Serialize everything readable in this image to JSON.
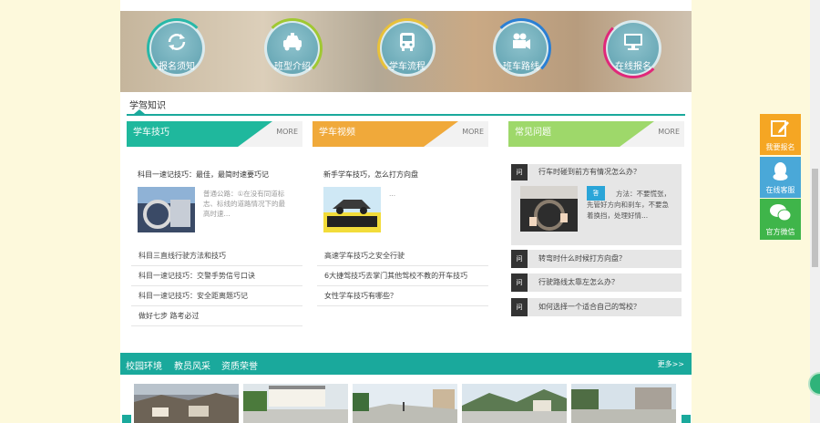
{
  "hero": {
    "items": [
      {
        "label": "报名须知",
        "icon": "refresh-icon",
        "arc_color": "#28b8a8"
      },
      {
        "label": "班型介绍",
        "icon": "car-icon",
        "arc_color": "#a0c832"
      },
      {
        "label": "学车流程",
        "icon": "bus-icon",
        "arc_color": "#e8c13a"
      },
      {
        "label": "班车路线",
        "icon": "camera-icon",
        "arc_color": "#2a7fd4"
      },
      {
        "label": "在线报名",
        "icon": "monitor-icon",
        "arc_color": "#e0287a"
      }
    ]
  },
  "knowledge": {
    "title": "学驾知识",
    "accent": "#1aa99c"
  },
  "columns": [
    {
      "tab": "学车技巧",
      "more": "MORE",
      "color": "#1fb89d",
      "feature_title": "科目一速记技巧：最佳，最简时速要巧记",
      "feature_text": "普通公路：①在没有同道标志、标线的道路情况下的最高时速...",
      "list": [
        "科目三直线行驶方法和技巧",
        "科目一速记技巧：交警手势信号口诀",
        "科目一速记技巧：安全距离题巧记",
        "做好七步 路考必过"
      ]
    },
    {
      "tab": "学车视频",
      "more": "MORE",
      "color": "#f0a93a",
      "feature_title": "新手学车技巧，怎么打方向盘",
      "feature_text": "...",
      "list": [
        "高速学车技巧之安全行驶",
        "6大捷驾技巧去掌门其他驾校不教的开车技巧",
        "女性学车技巧有哪些？"
      ]
    },
    {
      "tab": "常见问题",
      "more": "MORE",
      "color": "#9ed86a",
      "q_badge": "问",
      "a_badge": "答",
      "featured_q": "行车时碰到前方有情况怎么办？",
      "featured_a": "方法：不要慌张，先管好方向和刹车，不要急着换挡，处理好情...",
      "list": [
        "转弯时什么时候打方向盘？",
        "行驶路线太靠左怎么办？",
        "如何选择一个适合自己的驾校？"
      ]
    }
  ],
  "gallery": {
    "tabs": [
      "校园环境",
      "教员风采",
      "资质荣誉"
    ],
    "more": "更多>>",
    "images": [
      "campus-village",
      "campus-building",
      "campus-court",
      "campus-mountain",
      "campus-yard"
    ]
  },
  "sidebar": {
    "buttons": [
      {
        "label": "我要报名",
        "icon": "edit-icon",
        "color": "#f5a623"
      },
      {
        "label": "在线客服",
        "icon": "qq-icon",
        "color": "#4aa8d8"
      },
      {
        "label": "官方微信",
        "icon": "wechat-icon",
        "color": "#3fb54a"
      }
    ]
  }
}
